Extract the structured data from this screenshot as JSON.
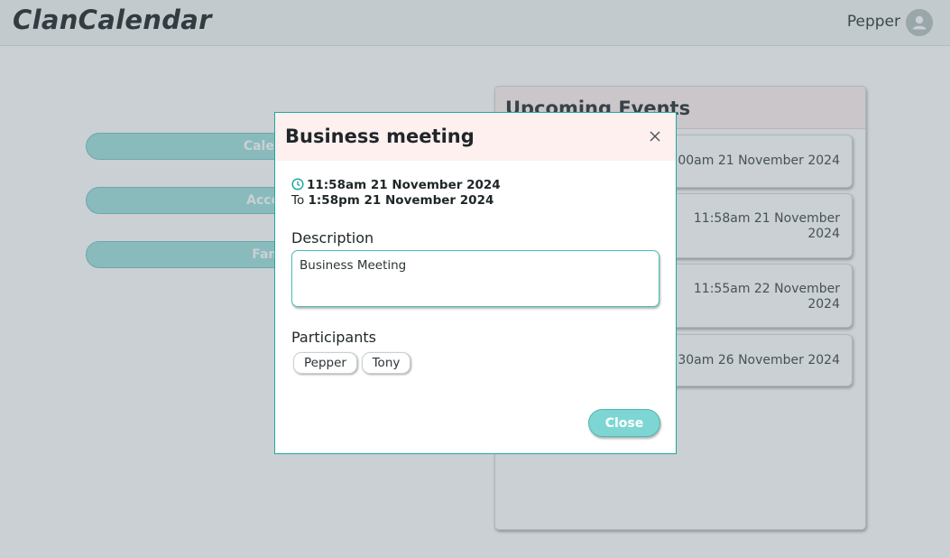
{
  "app": {
    "title": "ClanCalendar"
  },
  "user": {
    "name": "Pepper",
    "avatar_icon": "person-icon"
  },
  "nav": [
    {
      "label": "Calendar"
    },
    {
      "label": "Account"
    },
    {
      "label": "Family"
    }
  ],
  "upcoming": {
    "title": "Upcoming Events",
    "events": [
      {
        "time": "9:00am 21 November 2024"
      },
      {
        "time": "11:58am 21 November 2024"
      },
      {
        "time": "11:55am 22 November 2024"
      },
      {
        "time": "9:30am 26 November 2024"
      }
    ]
  },
  "modal": {
    "title": "Business meeting",
    "start": "11:58am 21 November 2024",
    "to_label": "To",
    "end": "1:58pm 21 November 2024",
    "description_label": "Description",
    "description": "Business Meeting",
    "participants_label": "Participants",
    "participants": [
      "Pepper",
      "Tony"
    ],
    "close_label": "Close"
  },
  "colors": {
    "accent": "#7ed6d4",
    "modal_border": "#1fa9a2",
    "modal_header": "#fff0f0"
  }
}
